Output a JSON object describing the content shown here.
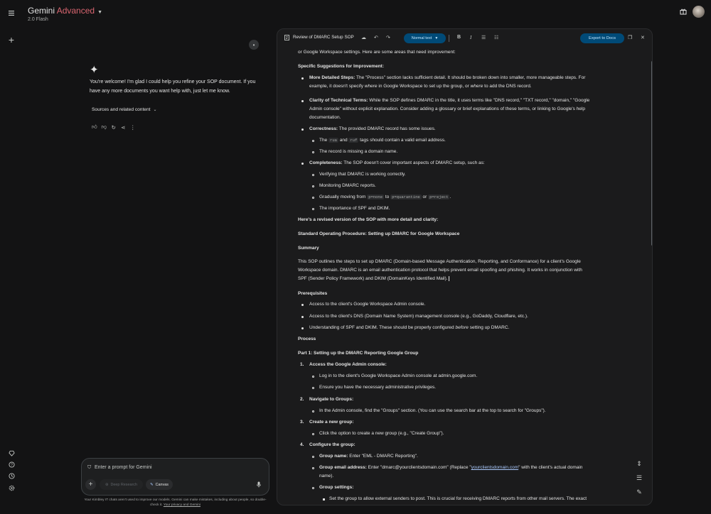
{
  "header": {
    "app_name": "Gemini",
    "plan": "Advanced",
    "model": "2.0 Flash"
  },
  "icons": {
    "menu": "menu-icon",
    "new_chat": "plus-icon",
    "gift": "gift-icon",
    "gems": "gem-icon",
    "help": "help-icon",
    "activity": "history-icon",
    "settings": "gear-icon"
  },
  "chat": {
    "message": "You're welcome! I'm glad I could help you refine your SOP document. If you have any more documents you want help with, just let me know.",
    "sources_label": "Sources and related content"
  },
  "composer": {
    "placeholder": "Enter a prompt for Gemini",
    "deep_research": "Deep Research",
    "canvas": "Canvas"
  },
  "footer": {
    "text": "Your Kimbley IT chats aren't used to improve our models. Gemini can make mistakes, including about people, so double-check it.",
    "link": "Your privacy and Gemini"
  },
  "doc": {
    "title": "Review of DMARC Setup SOP",
    "format": "Normal text",
    "export": "Export to Docs",
    "intro": "or Google Workspace settings.  Here are some areas that need improvement:",
    "s1": "Specific Suggestions for Improvement:",
    "i1_b": "More Detailed Steps:",
    "i1_t1": " The \"Process\" section lacks sufficient detail.  It should be broken down into smaller, more manageable steps.  For",
    "i1_t2a": "example, it doesn't specify ",
    "i1_t2b": "where",
    "i1_t2c": " in Google Workspace to set up the group, or ",
    "i1_t2d": "where",
    "i1_t2e": " to add the DNS record.",
    "i2_b": "Clarity of Technical Terms:",
    "i2_t1": " While the SOP defines DMARC in the title, it uses terms like \"DNS record,\" \"TXT record,\" \"domain,\" \"Google",
    "i2_t2": "Admin console\" without explicit explanation. Consider adding a glossary or brief explanations of these terms, or linking to Google's help",
    "i2_t3": "documentation.",
    "i3_b": "Correctness:",
    "i3_t": " The provided DMARC record has some issues.",
    "i3_s1a": "The ",
    "i3_s1_c1": "rua",
    "i3_s1b": " and ",
    "i3_s1_c2": "ruf",
    "i3_s1c": " tags should contain a valid email address.",
    "i3_s2": "The record is missing a domain name.",
    "i4_b": "Completeness:",
    "i4_t": " The SOP doesn't cover important aspects of DMARC setup, such as:",
    "i4_s1": "Verifying that DMARC is working correctly.",
    "i4_s2": "Monitoring DMARC reports.",
    "i4_s3a": "Gradually moving from ",
    "i4_s3_c1": "p=none",
    "i4_s3b": " to ",
    "i4_s3_c2": "p=quarantine",
    "i4_s3c": " or ",
    "i4_s3_c3": "p=reject",
    "i4_s3d": ".",
    "i4_s4": "The importance of SPF and DKIM.",
    "h_rev": "Here's a revised version of the SOP with more detail and clarity:",
    "h_sop": "Standard Operating Procedure: Setting up DMARC for Google Workspace",
    "h_sum": "Summary",
    "sum1": "This SOP outlines the steps to set up DMARC (Domain-based Message Authentication, Reporting, and Conformance) for a client's Google",
    "sum2": "Workspace domain. DMARC is an email authentication protocol that helps prevent email spoofing and phishing.  It works in conjunction with",
    "sum3": "SPF (Sender Policy Framework) and DKIM (DomainKeys Identified Mail).",
    "h_pre": "Prerequisites",
    "pre1": "Access to the client's Google Workspace Admin console.",
    "pre2": "Access to the client's DNS (Domain Name System) management console (e.g., GoDaddy, Cloudflare, etc.).",
    "pre3a": "Understanding of SPF and DKIM.  These should be properly configured ",
    "pre3b": "before",
    "pre3c": " setting up DMARC.",
    "h_proc": "Process",
    "h_p1": "Part 1: Setting up the DMARC Reporting Google Group",
    "n1": "1.",
    "st1": "Access the Google Admin console:",
    "st1_a": "Log in to the client's Google Workspace Admin console at admin.google.com.",
    "st1_b": "Ensure you have the necessary administrative privileges.",
    "n2": "2.",
    "st2": "Navigate to Groups:",
    "st2_a": "In the Admin console, find the \"Groups\" section.  (You can use the search bar at the top to search for \"Groups\").",
    "n3": "3.",
    "st3": "Create a new group:",
    "st3_a": "Click the option to create a new group (e.g., \"Create Group\").",
    "n4": "4.",
    "st4": "Configure the group:",
    "gn_b": "Group name:",
    "gn_t": " Enter \"EML - DMARC Reporting\".",
    "ge_b": "Group email address:",
    "ge_t1": " Enter \"dmarc@yourclientsdomain.com\" (Replace \"",
    "ge_link": "yourclientsdomain.com",
    "ge_t2": "\" with the client's actual domain",
    "ge_t3": "name).",
    "gs_b": "Group settings:",
    "gs_t": "Set the group to allow external senders to post. This is crucial for receiving DMARC reports from other mail servers.  The exact"
  }
}
